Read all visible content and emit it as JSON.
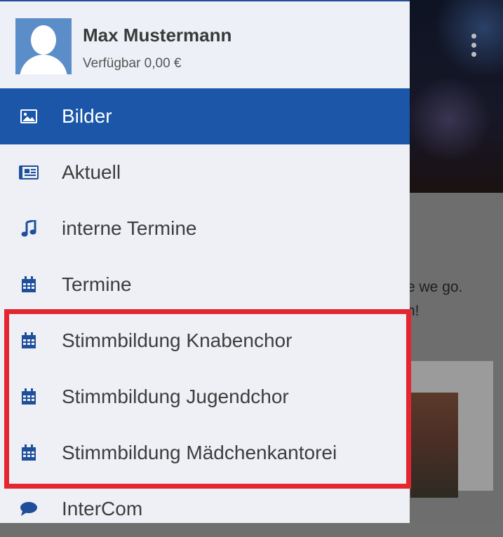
{
  "background": {
    "snippet_line1": "e we go.",
    "snippet_line2": "n!"
  },
  "drawer": {
    "user": {
      "name": "Max Mustermann",
      "balance": "Verfügbar 0,00 €"
    },
    "items": [
      {
        "label": "Bilder",
        "icon": "image-icon",
        "active": true
      },
      {
        "label": "Aktuell",
        "icon": "newspaper-icon"
      },
      {
        "label": "interne Termine",
        "icon": "music-note-icon"
      },
      {
        "label": "Termine",
        "icon": "calendar-icon"
      },
      {
        "label": "Stimmbildung Knabenchor",
        "icon": "calendar-icon"
      },
      {
        "label": "Stimmbildung Jugendchor",
        "icon": "calendar-icon"
      },
      {
        "label": "Stimmbildung Mädchenkantorei",
        "icon": "calendar-icon"
      },
      {
        "label": "InterCom",
        "icon": "speech-bubble-icon"
      }
    ]
  },
  "colors": {
    "accent": "#1b56a8",
    "highlight": "#e3262f"
  }
}
